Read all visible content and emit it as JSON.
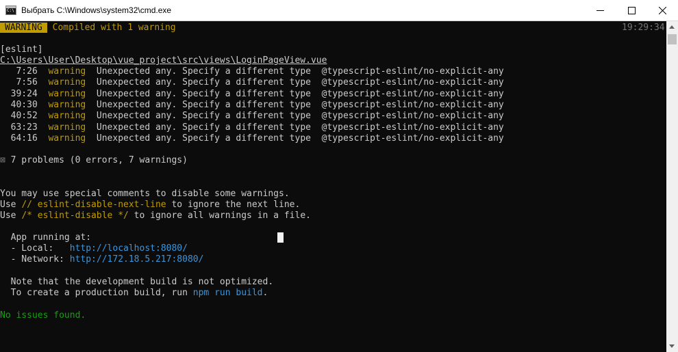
{
  "window": {
    "title": "Выбрать C:\\Windows\\system32\\cmd.exe"
  },
  "terminal": {
    "status_badge": "WARNING",
    "status_text": "Compiled with 1 warning",
    "timestamp": "19:29:34",
    "eslint_tag": "[eslint]",
    "file_path": "C:\\Users\\User\\Desktop\\vue_project\\src\\views\\LoginPageView.vue",
    "warnings": [
      {
        "loc": "7:26",
        "level": "warning",
        "message": "Unexpected any. Specify a different type",
        "rule": "@typescript-eslint/no-explicit-any"
      },
      {
        "loc": "7:56",
        "level": "warning",
        "message": "Unexpected any. Specify a different type",
        "rule": "@typescript-eslint/no-explicit-any"
      },
      {
        "loc": "39:24",
        "level": "warning",
        "message": "Unexpected any. Specify a different type",
        "rule": "@typescript-eslint/no-explicit-any"
      },
      {
        "loc": "40:30",
        "level": "warning",
        "message": "Unexpected any. Specify a different type",
        "rule": "@typescript-eslint/no-explicit-any"
      },
      {
        "loc": "40:52",
        "level": "warning",
        "message": "Unexpected any. Specify a different type",
        "rule": "@typescript-eslint/no-explicit-any"
      },
      {
        "loc": "63:23",
        "level": "warning",
        "message": "Unexpected any. Specify a different type",
        "rule": "@typescript-eslint/no-explicit-any"
      },
      {
        "loc": "64:16",
        "level": "warning",
        "message": "Unexpected any. Specify a different type",
        "rule": "@typescript-eslint/no-explicit-any"
      }
    ],
    "problems_glyph": "⊠",
    "problems_summary": "7 problems (0 errors, 7 warnings)",
    "hint_line1": "You may use special comments to disable some warnings.",
    "hint_line2": {
      "prefix": "Use ",
      "code": "// eslint-disable-next-line",
      "suffix": " to ignore the next line."
    },
    "hint_line3": {
      "prefix": "Use ",
      "code": "/* eslint-disable */",
      "suffix": " to ignore all warnings in a file."
    },
    "app_running": "  App running at:",
    "local": {
      "label": "  - Local:   ",
      "url_prefix": "http://localhost:",
      "port": "8080",
      "url_suffix": "/"
    },
    "network": {
      "label": "  - Network: ",
      "url_prefix": "http://172.18.5.217:",
      "port": "8080",
      "url_suffix": "/"
    },
    "note_line1": "  Note that the development build is not optimized.",
    "note_line2": {
      "prefix": "  To create a production build, run ",
      "command": "npm run build",
      "suffix": "."
    },
    "no_issues": "No issues found."
  },
  "colors": {
    "background": "#0c0c0c",
    "text": "#cccccc",
    "warning_yellow": "#c19c00",
    "link_blue": "#3a96dd",
    "success_green": "#13a10e"
  }
}
